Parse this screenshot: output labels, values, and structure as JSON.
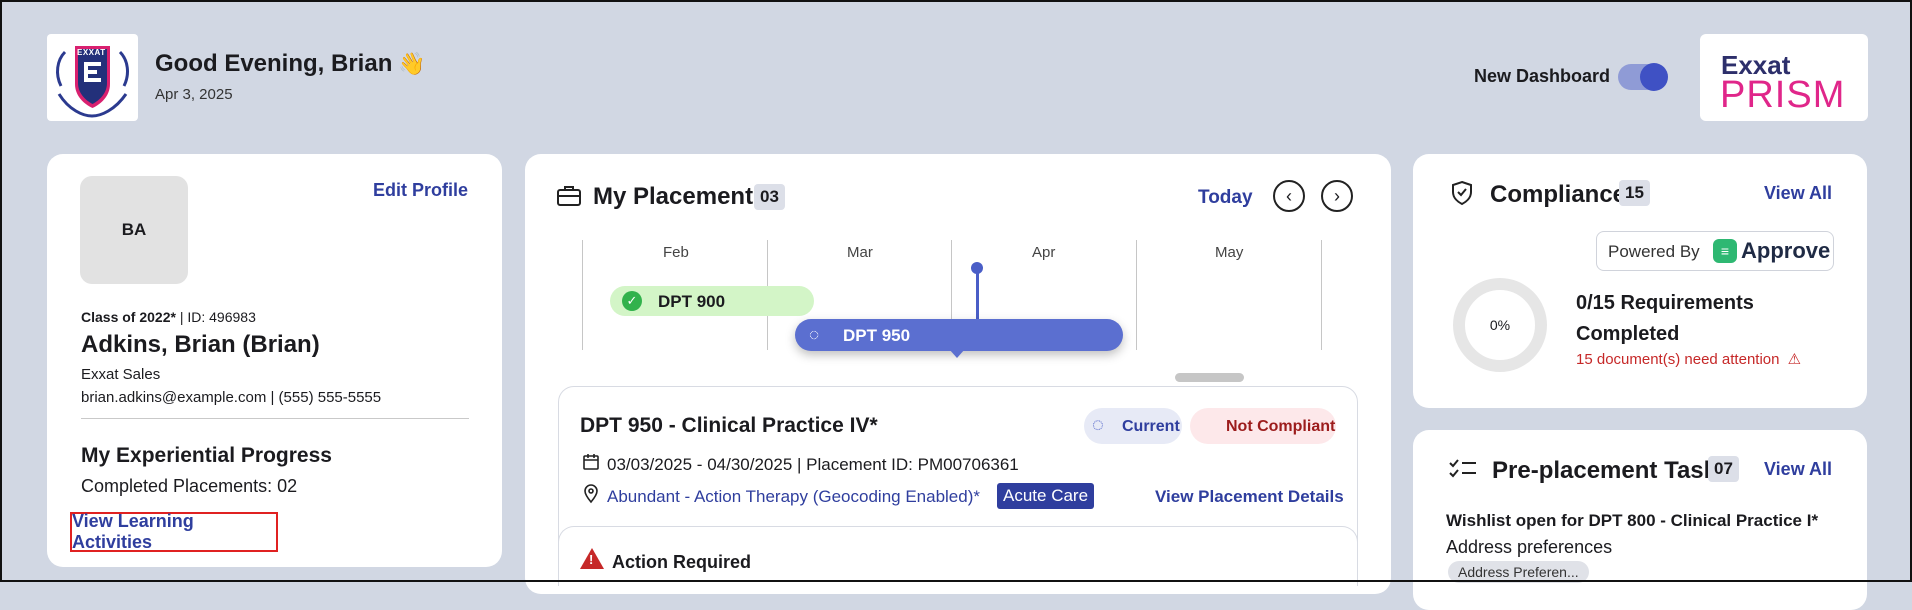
{
  "header": {
    "greeting": "Good Evening, Brian",
    "wave": "👋",
    "date": "Apr 3, 2025",
    "new_dashboard_label": "New Dashboard",
    "new_dashboard_on": true,
    "brand_top": "Exxat",
    "brand_bottom": "PRISM",
    "logo_text": "EXXAT"
  },
  "profile": {
    "initials": "BA",
    "edit_label": "Edit Profile",
    "class_of": "Class of 2022*",
    "id_text": " | ID: 496983",
    "name": "Adkins, Brian (Brian)",
    "org": "Exxat Sales",
    "email": "brian.adkins@example.com",
    "phone": " | (555) 555-5555",
    "progress_title": "My Experiential Progress",
    "completed_placements": "Completed Placements: 02",
    "view_learning_label": "View Learning Activities"
  },
  "placements": {
    "title": "My Placements",
    "count": "03",
    "today_label": "Today",
    "prev_icon": "chevron-left-icon",
    "next_icon": "chevron-right-icon",
    "months": [
      "Feb",
      "Mar",
      "Apr",
      "May"
    ],
    "timeline": [
      {
        "label": "DPT 900",
        "status": "completed"
      },
      {
        "label": "DPT 950",
        "status": "current"
      }
    ],
    "card": {
      "title": "DPT 950 - Clinical Practice IV*",
      "current_label": "Current",
      "compliance_label": "Not Compliant",
      "dates": "03/03/2025 - 04/30/2025 | Placement ID: PM00706361",
      "site": "Abundant - Action Therapy (Geocoding Enabled)*",
      "site_tag": "Acute Care",
      "details_label": "View Placement Details"
    },
    "action_label": "Action Required"
  },
  "compliance": {
    "title": "Compliance",
    "count": "15",
    "view_all": "View All",
    "powered_by": "Powered By",
    "approve_brand": "Approve",
    "percent": "0%",
    "progress_fraction": 0,
    "requirements": "0/15 Requirements Completed",
    "attention": "15 document(s) need attention"
  },
  "preplacement": {
    "title": "Pre-placement Tasks",
    "count": "07",
    "view_all": "View All",
    "task_title": "Wishlist open for DPT 800 - Clinical Practice I*",
    "task_sub": "Address preferences",
    "task_chip": "Address Preferen..."
  },
  "colors": {
    "background": "#d1d7e3",
    "accent": "#2f3e9e",
    "current_pill": "#5b6fd0",
    "completed_pill": "#d3f5c7",
    "danger": "#c62828",
    "brand_pink": "#e0268a"
  }
}
